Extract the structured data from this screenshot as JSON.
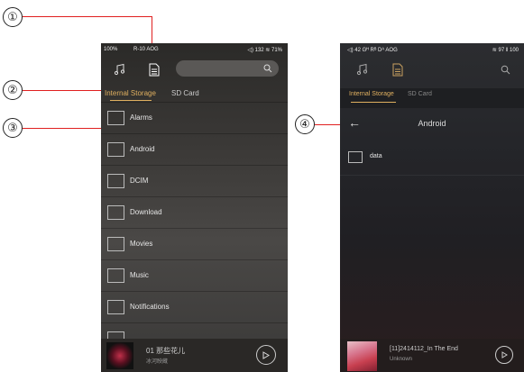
{
  "callouts": [
    "①",
    "②",
    "③",
    "④"
  ],
  "phone1": {
    "status": {
      "battery": "100%",
      "info": "R-10  AOG",
      "right": "◁) 132  ≋  71%"
    },
    "tabs": {
      "internal": "Internal Storage",
      "sd": "SD Card"
    },
    "folders": [
      "Alarms",
      "Android",
      "DCIM",
      "Download",
      "Movies",
      "Music",
      "Notifications"
    ],
    "player": {
      "title": "01 那些花儿",
      "artist": "冰河映蔵"
    }
  },
  "phone2": {
    "status": {
      "left": "◁) 42  Gᴴ Rᴮ Dᴬ AOG",
      "right": "≋ 97 ‖ 100"
    },
    "tabs": {
      "internal": "Internal Storage",
      "sd": "SD Card"
    },
    "header": {
      "back": "←",
      "title": "Android"
    },
    "folders": [
      "data"
    ],
    "player": {
      "title": "[11]2414112_In The End",
      "artist": "Unknown"
    }
  },
  "colors": {
    "accent": "#e0b060",
    "callout_line": "#e02020"
  }
}
